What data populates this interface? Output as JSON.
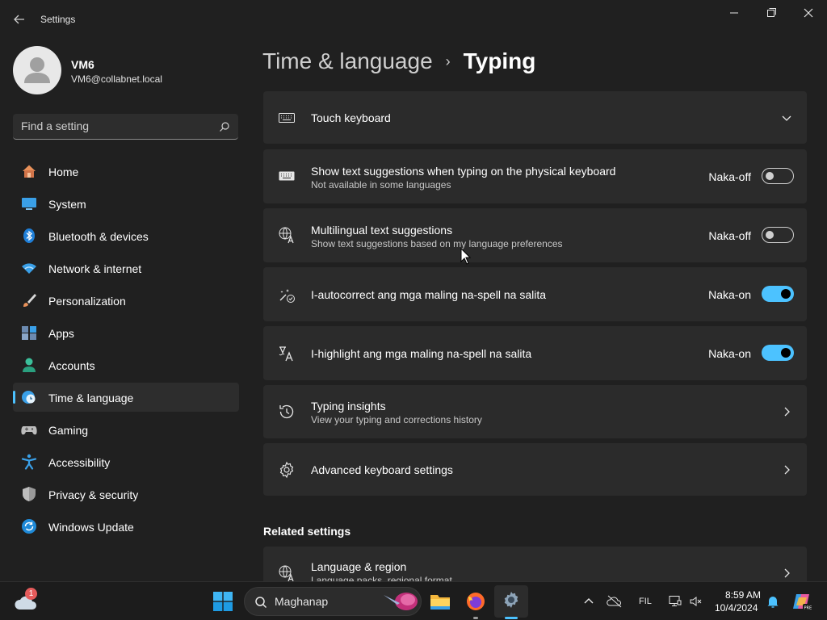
{
  "window": {
    "title": "Settings",
    "controls": [
      "minimize",
      "maximize",
      "close"
    ]
  },
  "user": {
    "name": "VM6",
    "email": "VM6@collabnet.local"
  },
  "search": {
    "placeholder": "Find a setting"
  },
  "nav": {
    "items": [
      {
        "label": "Home",
        "icon": "home-icon"
      },
      {
        "label": "System",
        "icon": "system-icon"
      },
      {
        "label": "Bluetooth & devices",
        "icon": "bluetooth-icon"
      },
      {
        "label": "Network & internet",
        "icon": "wifi-icon"
      },
      {
        "label": "Personalization",
        "icon": "brush-icon"
      },
      {
        "label": "Apps",
        "icon": "apps-icon"
      },
      {
        "label": "Accounts",
        "icon": "accounts-icon"
      },
      {
        "label": "Time & language",
        "icon": "globe-clock-icon",
        "active": true
      },
      {
        "label": "Gaming",
        "icon": "gamepad-icon"
      },
      {
        "label": "Accessibility",
        "icon": "accessibility-icon"
      },
      {
        "label": "Privacy & security",
        "icon": "shield-icon"
      },
      {
        "label": "Windows Update",
        "icon": "update-icon"
      }
    ]
  },
  "breadcrumb": {
    "parent": "Time & language",
    "separator": "›",
    "current": "Typing"
  },
  "settings": {
    "touch_keyboard": {
      "title": "Touch keyboard"
    },
    "text_suggestions": {
      "title": "Show text suggestions when typing on the physical keyboard",
      "subtitle": "Not available in some languages",
      "state_label": "Naka-off",
      "on": false
    },
    "multilingual": {
      "title": "Multilingual text suggestions",
      "subtitle": "Show text suggestions based on my language preferences",
      "state_label": "Naka-off",
      "on": false
    },
    "autocorrect": {
      "title": "I-autocorrect ang mga maling na-spell na salita",
      "state_label": "Naka-on",
      "on": true
    },
    "highlight": {
      "title": "I-highlight ang mga maling na-spell na salita",
      "state_label": "Naka-on",
      "on": true
    },
    "typing_insights": {
      "title": "Typing insights",
      "subtitle": "View your typing and corrections history"
    },
    "advanced_keyboard": {
      "title": "Advanced keyboard settings"
    }
  },
  "related": {
    "heading": "Related settings",
    "language_region": {
      "title": "Language & region",
      "subtitle": "Language packs, regional format"
    }
  },
  "taskbar": {
    "weather_badge": "1",
    "search_label": "Maghanap",
    "apps": [
      "file-explorer-icon",
      "firefox-icon",
      "settings-icon"
    ],
    "tray": {
      "language": "FIL",
      "time": "8:59 AM",
      "date": "10/4/2024"
    }
  },
  "colors": {
    "accent": "#4cc2ff",
    "background": "#202020",
    "card": "#2b2b2b"
  }
}
